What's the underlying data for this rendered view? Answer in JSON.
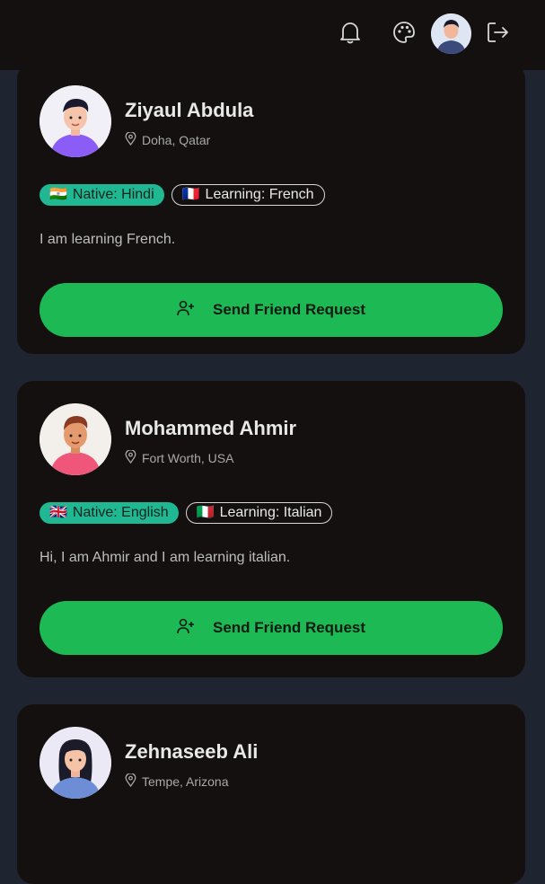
{
  "header": {
    "notification_icon": "bell-icon",
    "theme_icon": "palette-icon",
    "logout_icon": "logout-icon"
  },
  "colors": {
    "accent": "#1db954",
    "native_badge": "#1fb892",
    "card_bg": "#141010",
    "page_bg": "#1e2430"
  },
  "friends": [
    {
      "name": "Ziyaul Abdula",
      "location": "Doha, Qatar",
      "native_flag": "🇮🇳",
      "native": "Native: Hindi",
      "learning_flag": "🇫🇷",
      "learning": "Learning: French",
      "bio": "I am learning French.",
      "button": "Send Friend Request"
    },
    {
      "name": "Mohammed Ahmir",
      "location": "Fort Worth, USA",
      "native_flag": "🇬🇧",
      "native": "Native: English",
      "learning_flag": "🇮🇹",
      "learning": "Learning: Italian",
      "bio": "Hi, I am Ahmir and I am learning italian.",
      "button": "Send Friend Request"
    },
    {
      "name": "Zehnaseeb Ali",
      "location": "Tempe, Arizona"
    }
  ]
}
